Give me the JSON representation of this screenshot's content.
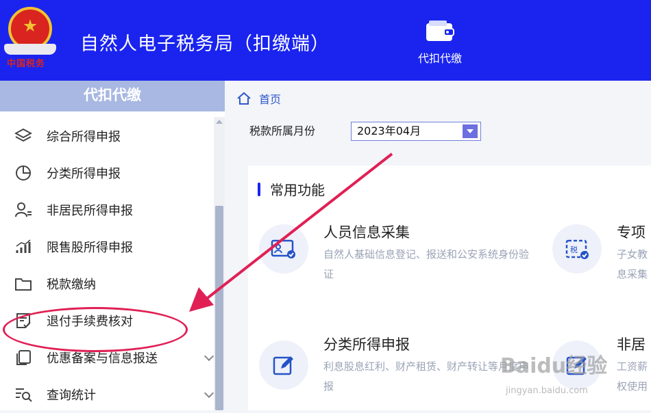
{
  "header": {
    "brand_text": "中国税务",
    "app_title": "自然人电子税务局（扣缴端）",
    "nav_item": {
      "label": "代扣代缴",
      "icon": "wallet-icon"
    }
  },
  "sidebar": {
    "title": "代扣代缴",
    "items": [
      {
        "label": "综合所得申报",
        "icon": "layers-icon"
      },
      {
        "label": "分类所得申报",
        "icon": "pie-chart-icon"
      },
      {
        "label": "非居民所得申报",
        "icon": "person-list-icon"
      },
      {
        "label": "限售股所得申报",
        "icon": "bar-chart-icon"
      },
      {
        "label": "税款缴纳",
        "icon": "folder-icon"
      },
      {
        "label": "退付手续费核对",
        "icon": "document-check-icon"
      },
      {
        "label": "优惠备案与信息报送",
        "icon": "copy-icon"
      },
      {
        "label": "查询统计",
        "icon": "list-search-icon"
      }
    ]
  },
  "main": {
    "breadcrumb": "首页",
    "period": {
      "label": "税款所属月份",
      "value": "2023年04月"
    },
    "section_title": "常用功能",
    "cards": [
      {
        "title": "人员信息采集",
        "desc": "自然人基础信息登记、报送和公安系统身份验证",
        "icon": "id-card-icon"
      },
      {
        "title": "专项",
        "desc": "子女教息采集",
        "icon": "tax-document-icon"
      },
      {
        "title": "分类所得申报",
        "desc": "利息股息红利、财产租赁、财产转让等月度申报",
        "icon": "edit-icon"
      },
      {
        "title": "非居",
        "desc": "工资薪权使用",
        "icon": "edit-icon"
      }
    ]
  },
  "watermark": {
    "text": "Baidu经验",
    "sub": "jingyan.baidu.com"
  },
  "colors": {
    "header_bg": "#1a24ee",
    "sidebar_title_bg": "#a8b8e2",
    "annotation": "#e02055"
  }
}
